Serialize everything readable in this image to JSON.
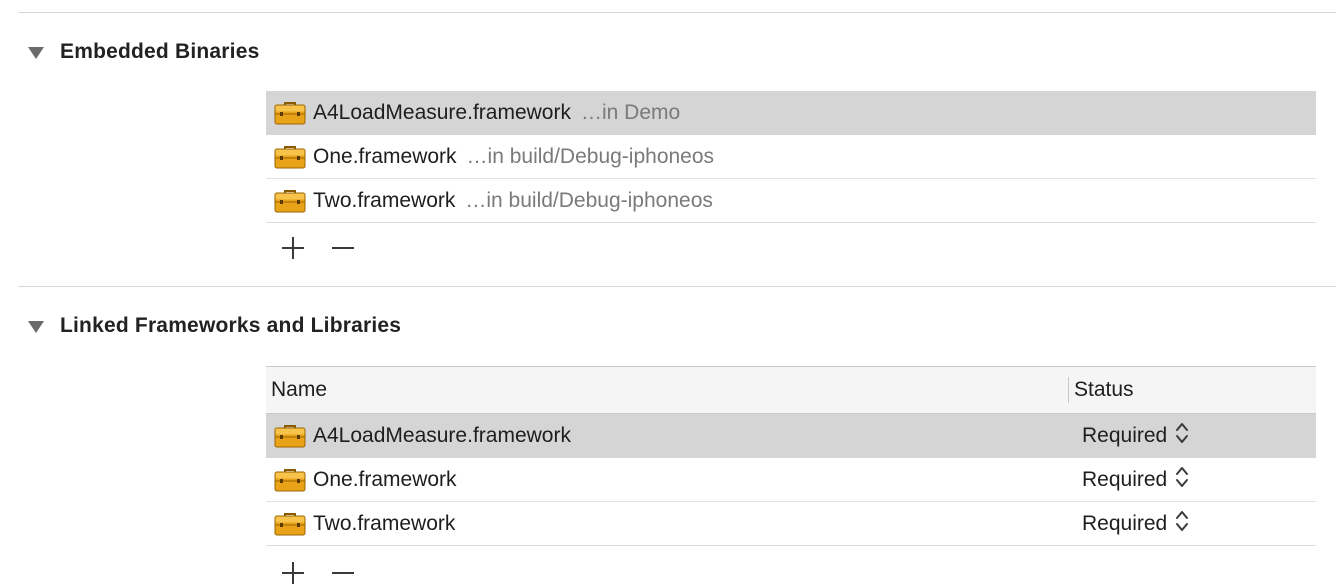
{
  "embedded": {
    "title": "Embedded Binaries",
    "items": [
      {
        "name": "A4LoadMeasure.framework",
        "path": "…in Demo",
        "selected": true
      },
      {
        "name": "One.framework",
        "path": "…in build/Debug-iphoneos",
        "selected": false
      },
      {
        "name": "Two.framework",
        "path": "…in build/Debug-iphoneos",
        "selected": false
      }
    ]
  },
  "linked": {
    "title": "Linked Frameworks and Libraries",
    "columns": {
      "name": "Name",
      "status": "Status"
    },
    "items": [
      {
        "name": "A4LoadMeasure.framework",
        "status": "Required",
        "selected": true
      },
      {
        "name": "One.framework",
        "status": "Required",
        "selected": false
      },
      {
        "name": "Two.framework",
        "status": "Required",
        "selected": false
      }
    ]
  },
  "icons": {
    "framework": "toolbox-icon",
    "disclosure": "disclosure-triangle-icon",
    "add": "plus-icon",
    "remove": "minus-icon",
    "stepper": "up-down-chevron-icon"
  },
  "colors": {
    "selection": "#d5d5d5",
    "toolbox": "#e9a318",
    "path_text": "#7a7a7a"
  }
}
